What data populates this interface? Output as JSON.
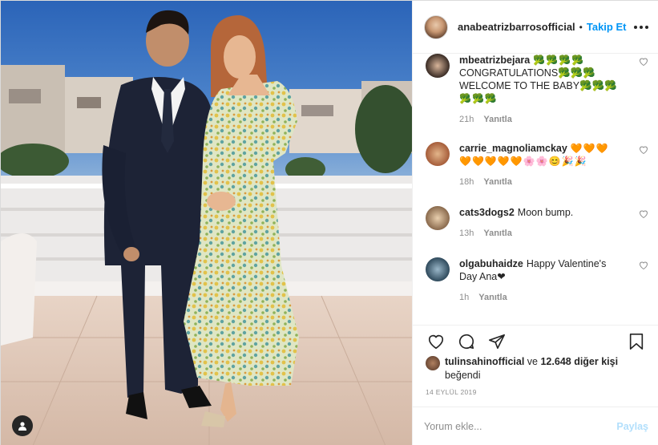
{
  "post": {
    "owner": "anabeatrizbarrosofficial",
    "separator": "•",
    "follow_label": "Takip Et",
    "more_icon": "more-options-icon"
  },
  "comments": [
    {
      "user": "mbeatrizbejara",
      "text_a": "🥦🥦🥦🥦",
      "text_b": "CONGRATULATIONS🥦🥦🥦",
      "text_c": "WELCOME TO THE BABY🥦🥦🥦",
      "text_d": "🥦🥦🥦",
      "time": "21h",
      "reply": "Yanıtla"
    },
    {
      "user": "carrie_magnoliamckay",
      "text_a": "🧡🧡🧡",
      "text_b": "🧡🧡🧡🧡🧡🌸🌸😊🎉🎉",
      "time": "18h",
      "reply": "Yanıtla"
    },
    {
      "user": "cats3dogs2",
      "text_a": "Moon bump.",
      "time": "13h",
      "reply": "Yanıtla"
    },
    {
      "user": "olgabuhaidze",
      "text_a": "Happy Valentine's",
      "text_b": "Day Ana❤",
      "time": "1h",
      "reply": "Yanıtla"
    }
  ],
  "actions": {
    "icons": [
      "heart-icon",
      "comment-icon",
      "share-icon",
      "save-icon"
    ]
  },
  "likes": {
    "liker": "tulinsahinofficial",
    "connector": "ve",
    "others": "12.648 diğer kişi",
    "verb": "beğendi"
  },
  "date": "14 EYLÜL 2019",
  "add_comment": {
    "placeholder": "Yorum ekle...",
    "post_label": "Paylaş"
  },
  "colors": {
    "accent": "#0095f6",
    "post_disabled": "#b2dffc",
    "text": "#262626",
    "muted": "#8e8e8e",
    "heart": "#ed4956"
  }
}
